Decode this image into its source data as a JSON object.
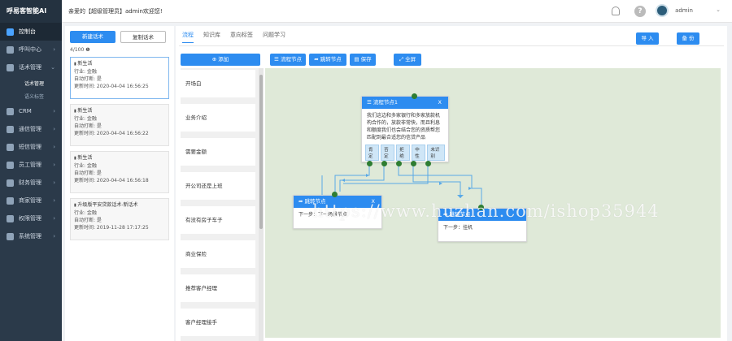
{
  "app": {
    "brand": "呼易客智能AI"
  },
  "sidebar": {
    "items": [
      {
        "label": "控制台",
        "icon": "dashboard-icon",
        "active": true
      },
      {
        "label": "呼叫中心",
        "icon": "phone-icon"
      },
      {
        "label": "话术管理",
        "icon": "chat-icon",
        "expanded": true
      },
      {
        "label": "CRM",
        "icon": "crm-icon"
      },
      {
        "label": "通信管理",
        "icon": "comm-icon"
      },
      {
        "label": "短信管理",
        "icon": "sms-icon"
      },
      {
        "label": "员工管理",
        "icon": "staff-icon"
      },
      {
        "label": "财务管理",
        "icon": "finance-icon"
      },
      {
        "label": "商家管理",
        "icon": "merchant-icon"
      },
      {
        "label": "权限管理",
        "icon": "permission-icon"
      },
      {
        "label": "系统管理",
        "icon": "system-icon"
      }
    ],
    "subitems": [
      {
        "label": "话术管理",
        "active": true
      },
      {
        "label": "语义标签"
      }
    ]
  },
  "topbar": {
    "welcome": "亲爱的【超级管理员】admin欢迎您!",
    "username": "admin",
    "help_glyph": "?",
    "caret": "⌄"
  },
  "left_panel": {
    "new_button": "新建话术",
    "copy_button": "复制话术",
    "count": "4/100 ❶",
    "scripts": [
      {
        "title": "新生活",
        "industry": "行业: 金融",
        "auto_hangup": "自动打断: 是",
        "updated": "更新时间: 2020-04-04 16:56:25"
      },
      {
        "title": "新生活",
        "industry": "行业: 金融",
        "auto_hangup": "自动打断: 是",
        "updated": "更新时间: 2020-04-04 16:56:22"
      },
      {
        "title": "新生活",
        "industry": "行业: 金融",
        "auto_hangup": "自动打断: 是",
        "updated": "更新时间: 2020-04-04 16:56:18"
      },
      {
        "title": "升级版平安贷款话术-新话术",
        "industry": "行业: 金融",
        "auto_hangup": "自动打断: 是",
        "updated": "更新时间: 2019-11-28 17:17:25"
      }
    ]
  },
  "main": {
    "tabs": [
      "流程",
      "知识库",
      "意向标签",
      "问题学习"
    ],
    "import_button": "导 入",
    "backup_button": "备 份",
    "add_button": "添加",
    "flow_node_button": "流程节点",
    "jump_node_button": "跳转节点",
    "save_button": "保存",
    "fullscreen_button": "全屏",
    "list_items": [
      "开场白",
      "业务介绍",
      "需要金额",
      "开公司还是上班",
      "有没有房子车子",
      "商业保险",
      "推荐客户经理",
      "客户经理接手"
    ]
  },
  "flow": {
    "node1": {
      "title": "流程节点1",
      "close": "X",
      "text": "我们这边和多家银行和多家放款机构合作的，放款非常快，而且利息和额度我们也会结合您的资质帮您匹配到最合适您的信贷产品",
      "branches": [
        "肯定",
        "否定",
        "拒绝",
        "中性",
        "未识别"
      ]
    },
    "node2": {
      "title": "跳转节点",
      "close": "X",
      "text": "下一步：下一场景节点"
    },
    "node3": {
      "title": "跳转节点",
      "text": "下一步：挂机"
    }
  },
  "watermark": "https://www.huzhan.com/ishop35944",
  "colors": {
    "primary": "#2d8cf0",
    "sidebar": "#2b3a4a",
    "canvas": "#dfe9d8",
    "connector": "#5aa9e6",
    "dot": "#2e7d32"
  }
}
